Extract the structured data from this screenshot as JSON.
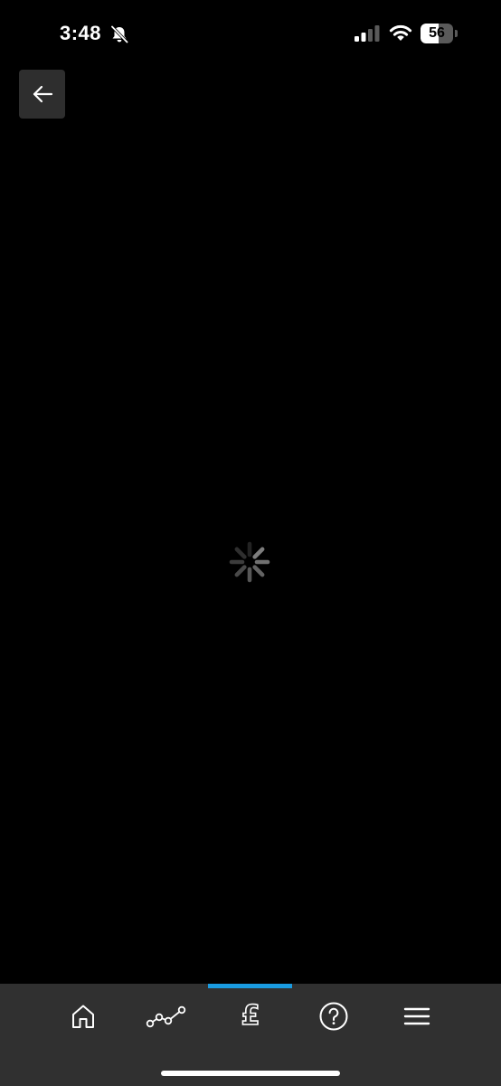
{
  "status_bar": {
    "time": "3:48",
    "battery_level": 56,
    "battery_label": "56",
    "signal_bars_active": 2,
    "signal_bars_total": 4,
    "icons": {
      "silent": "bell-slash-icon",
      "signal": "cellular-signal-icon",
      "wifi": "wifi-icon",
      "battery": "battery-icon"
    }
  },
  "header": {
    "back_icon": "arrow-left-icon"
  },
  "content": {
    "state": "loading",
    "spinner_icon": "loading-spinner-icon"
  },
  "bottom_nav": {
    "active_index": 2,
    "items": [
      {
        "id": "home",
        "icon": "home-icon"
      },
      {
        "id": "insights",
        "icon": "line-graph-icon"
      },
      {
        "id": "money",
        "icon": "pound-icon",
        "glyph": "£"
      },
      {
        "id": "help",
        "icon": "question-circle-icon",
        "glyph": "?"
      },
      {
        "id": "menu",
        "icon": "hamburger-menu-icon"
      }
    ]
  },
  "colors": {
    "background": "#000000",
    "nav_background": "#303030",
    "accent": "#1a9be0",
    "back_button_bg": "#2e2e2e",
    "icon": "#ffffff",
    "spinner": "#8a8a8a"
  }
}
